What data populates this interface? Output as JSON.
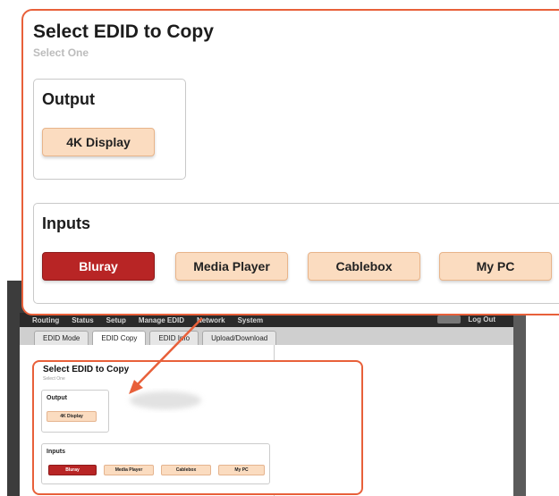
{
  "dialog": {
    "title": "Select EDID to Copy",
    "subtitle": "Select One",
    "output_group_label": "Output",
    "output_buttons": [
      "4K Display"
    ],
    "input_group_label": "Inputs",
    "input_buttons": [
      "Bluray",
      "Media Player",
      "Cablebox",
      "My PC"
    ],
    "selected_input": "Bluray"
  },
  "background_app": {
    "menu": [
      "Routing",
      "Status",
      "Setup",
      "Manage EDID",
      "Network",
      "System"
    ],
    "logout_label": "Log Out",
    "tabs": [
      "EDID Mode",
      "EDID Copy",
      "EDID Info",
      "Upload/Download"
    ],
    "active_tab": "EDID Copy"
  },
  "colors": {
    "accent_outline": "#e8603a",
    "button_fill": "#fbdcc0",
    "selected_fill": "#b82525"
  }
}
